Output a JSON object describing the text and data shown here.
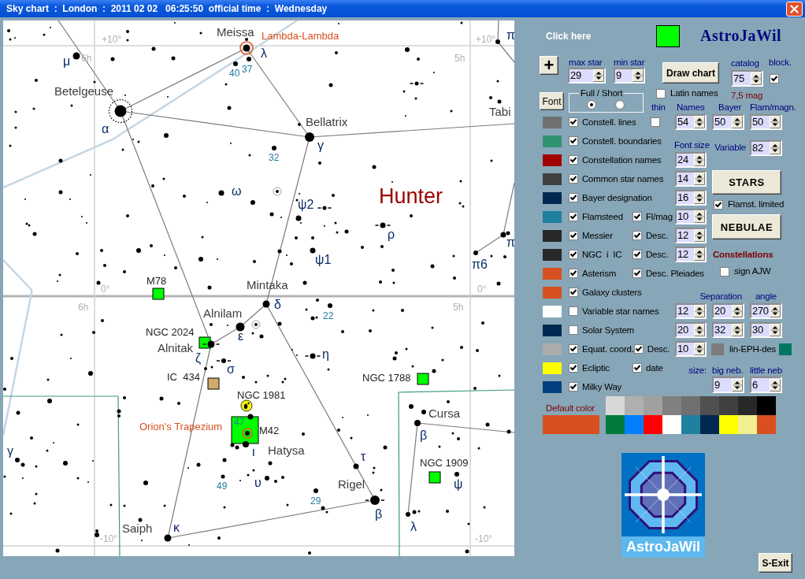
{
  "window": {
    "title": "Sky chart  :  London  :  2011 02 02   06:25:50  official time  :  Wednesday"
  },
  "sky_chart": {
    "grid_labels": [
      "+10°",
      "+10°",
      "6h",
      "5h",
      "0°",
      "0°",
      "6h",
      "5h",
      "-10°",
      "-10°"
    ],
    "labels": [
      {
        "text": "Meissa",
        "kind": "star_name"
      },
      {
        "text": "μ",
        "kind": "bayer"
      },
      {
        "text": "λ",
        "kind": "bayer"
      },
      {
        "text": "40",
        "kind": "flamsteed"
      },
      {
        "text": "37",
        "kind": "flamsteed"
      },
      {
        "text": "Betelgeuse",
        "kind": "star_name"
      },
      {
        "text": "α",
        "kind": "bayer"
      },
      {
        "text": "π",
        "kind": "bayer"
      },
      {
        "text": "Tabi",
        "kind": "star_name"
      },
      {
        "text": "Bellatrix",
        "kind": "star_name"
      },
      {
        "text": "γ",
        "kind": "bayer"
      },
      {
        "text": "32",
        "kind": "flamsteed"
      },
      {
        "text": "ω",
        "kind": "bayer"
      },
      {
        "text": "Hunter",
        "kind": "constellation"
      },
      {
        "text": "ψ2",
        "kind": "bayer"
      },
      {
        "text": "ρ",
        "kind": "bayer"
      },
      {
        "text": "π",
        "kind": "bayer"
      },
      {
        "text": "ψ1",
        "kind": "bayer"
      },
      {
        "text": "π6",
        "kind": "bayer"
      },
      {
        "text": "Mintaka",
        "kind": "star_name"
      },
      {
        "text": "δ",
        "kind": "bayer"
      },
      {
        "text": "Alnilam",
        "kind": "star_name"
      },
      {
        "text": "22",
        "kind": "flamsteed"
      },
      {
        "text": "ε",
        "kind": "bayer"
      },
      {
        "text": "Alnitak",
        "kind": "star_name"
      },
      {
        "text": "ζ",
        "kind": "bayer"
      },
      {
        "text": "η",
        "kind": "bayer"
      },
      {
        "text": "σ",
        "kind": "bayer"
      },
      {
        "text": "Cursa",
        "kind": "star_name"
      },
      {
        "text": "47",
        "kind": "flamsteed"
      },
      {
        "text": "β",
        "kind": "bayer"
      },
      {
        "text": "γ",
        "kind": "bayer"
      },
      {
        "text": "ι",
        "kind": "bayer"
      },
      {
        "text": "Hatysa",
        "kind": "star_name"
      },
      {
        "text": "τ",
        "kind": "bayer"
      },
      {
        "text": "49",
        "kind": "flamsteed"
      },
      {
        "text": "υ",
        "kind": "bayer"
      },
      {
        "text": "Rigel",
        "kind": "star_name"
      },
      {
        "text": "ψ",
        "kind": "bayer"
      },
      {
        "text": "29",
        "kind": "flamsteed"
      },
      {
        "text": "β",
        "kind": "bayer"
      },
      {
        "text": "Saiph",
        "kind": "star_name"
      },
      {
        "text": "κ",
        "kind": "bayer"
      },
      {
        "text": "λ",
        "kind": "bayer"
      }
    ],
    "deep_sky_objects": [
      {
        "name": "M78",
        "kind": "nebula",
        "color": "#00ff00"
      },
      {
        "name": "NGC 2024",
        "kind": "nebula",
        "color": "#00ff00"
      },
      {
        "name": "IC  434",
        "kind": "nebula",
        "color": "#d2aa6e"
      },
      {
        "name": "NGC 1981",
        "kind": "cluster",
        "color": "#ffff00"
      },
      {
        "name": "M42",
        "kind": "nebula",
        "color": "#00ff00"
      },
      {
        "name": "NGC 1788",
        "kind": "nebula",
        "color": "#00ff00"
      },
      {
        "name": "NGC 1909",
        "kind": "nebula",
        "color": "#00ff00"
      }
    ],
    "asterisms": [
      "Lambda-Lambda",
      "Orion's Trapezium"
    ]
  },
  "panel": {
    "click_here": "Click here",
    "brand": "AstroJaWil",
    "plus_button": "+",
    "star_limits": [
      {
        "label": "max star",
        "value": "29"
      },
      {
        "label": "min star",
        "value": "9"
      }
    ],
    "draw_button": "Draw chart",
    "catalog": {
      "label": "catalog",
      "value": "75"
    },
    "block": {
      "label": "block.",
      "checked": true
    },
    "latin_names": {
      "label": "Latin names",
      "checked": false
    },
    "magnitude": "7,5 mag",
    "font_button": "Font",
    "display_mode": {
      "legend": "Full / Short",
      "options": [
        {
          "selected": true
        },
        {
          "selected": false
        }
      ]
    },
    "column_headers": [
      "thin",
      "Names",
      "Bayer",
      "Flam/magn."
    ],
    "layers": [
      {
        "label": "Constell. lines",
        "color": "#707070",
        "checked": true,
        "option": {
          "checked": false
        },
        "values": [
          "54",
          "50",
          "50"
        ]
      },
      {
        "label": "Constell. boundaries",
        "color": "#319272",
        "checked": true
      },
      {
        "label": "Constellation names",
        "color": "#a00000",
        "checked": true,
        "values": [
          "24"
        ]
      },
      {
        "label": "Common star names",
        "color": "#404040",
        "checked": true,
        "values": [
          "14"
        ]
      },
      {
        "label": "Bayer designation",
        "color": "#002850",
        "checked": true,
        "values": [
          "16"
        ]
      },
      {
        "label": "Flamsteed",
        "color": "#2080a0",
        "checked": true,
        "option": {
          "label": "Fl/mag",
          "checked": true
        },
        "values": [
          "10"
        ]
      },
      {
        "label": "Messier",
        "color": "#282828",
        "checked": true,
        "option": {
          "label": "Desc.",
          "checked": true
        },
        "values": [
          "12"
        ]
      },
      {
        "label": "NGC  i  IC",
        "color": "#282828",
        "checked": true,
        "option": {
          "label": "Desc.",
          "checked": true
        },
        "values": [
          "12"
        ]
      },
      {
        "label": "Asterism",
        "color": "#d85020",
        "checked": true,
        "option": {
          "label": "Desc. Pleiades",
          "checked": true
        }
      },
      {
        "label": "Galaxy clusters",
        "color": "#d85020",
        "checked": true
      },
      {
        "label": "Variable star names",
        "color": "#ffffff",
        "checked": false,
        "values": [
          "12",
          "20",
          "270"
        ]
      },
      {
        "label": "Solar System",
        "color": "#002850",
        "checked": false,
        "values": [
          "20",
          "32",
          "30"
        ]
      },
      {
        "label": "Equat. coord.",
        "color": "#acacac",
        "checked": true,
        "option": {
          "label": "Desc.",
          "checked": true
        },
        "values": [
          "10"
        ]
      },
      {
        "label": "Ecliptic",
        "color": "#ffff00",
        "checked": true,
        "option": {
          "label": "date",
          "checked": true
        }
      },
      {
        "label": "Milky Way",
        "color": "#004080",
        "checked": true
      }
    ],
    "font_size_label": "Font size",
    "variable": {
      "label": "Variable",
      "value": "82"
    },
    "stars_button": "STARS",
    "flamsteed_limited": {
      "label": "Flamst. limited",
      "checked": true
    },
    "nebulae_button": "NEBULAE",
    "constellations_heading": "Constellations",
    "sign_ajw": {
      "label": "sign AJW",
      "checked": false
    },
    "separation_headers": [
      "Separation",
      "angle"
    ],
    "ephemeris": {
      "label": "lin-EPH-des",
      "swatches": [
        {
          "color": "#7c7c7c"
        },
        {
          "color": "#007560"
        }
      ]
    },
    "nebula_size": {
      "labels": [
        "size:",
        "big neb.",
        "little neb"
      ],
      "values": [
        "9",
        "6"
      ]
    },
    "default_color": {
      "label": "Default color",
      "color": "#d85020"
    },
    "palette": [
      {
        "color": "#d8d8d8"
      },
      {
        "color": "#b0b0b0"
      },
      {
        "color": "#a0a0a0"
      },
      {
        "color": "#808080"
      },
      {
        "color": "#707070"
      },
      {
        "color": "#505050"
      },
      {
        "color": "#404040"
      },
      {
        "color": "#282828"
      },
      {
        "color": "#000000"
      },
      {
        "color": "#007a3a"
      },
      {
        "color": "#0080ff"
      },
      {
        "color": "#ff0000"
      },
      {
        "color": "#ffffff"
      },
      {
        "color": "#2080a0"
      },
      {
        "color": "#002850"
      },
      {
        "color": "#ffff00"
      },
      {
        "color": "#f0f090"
      },
      {
        "color": "#d85020"
      }
    ],
    "logo_text": "AstroJaWil",
    "exit_button": "S-Exit"
  }
}
